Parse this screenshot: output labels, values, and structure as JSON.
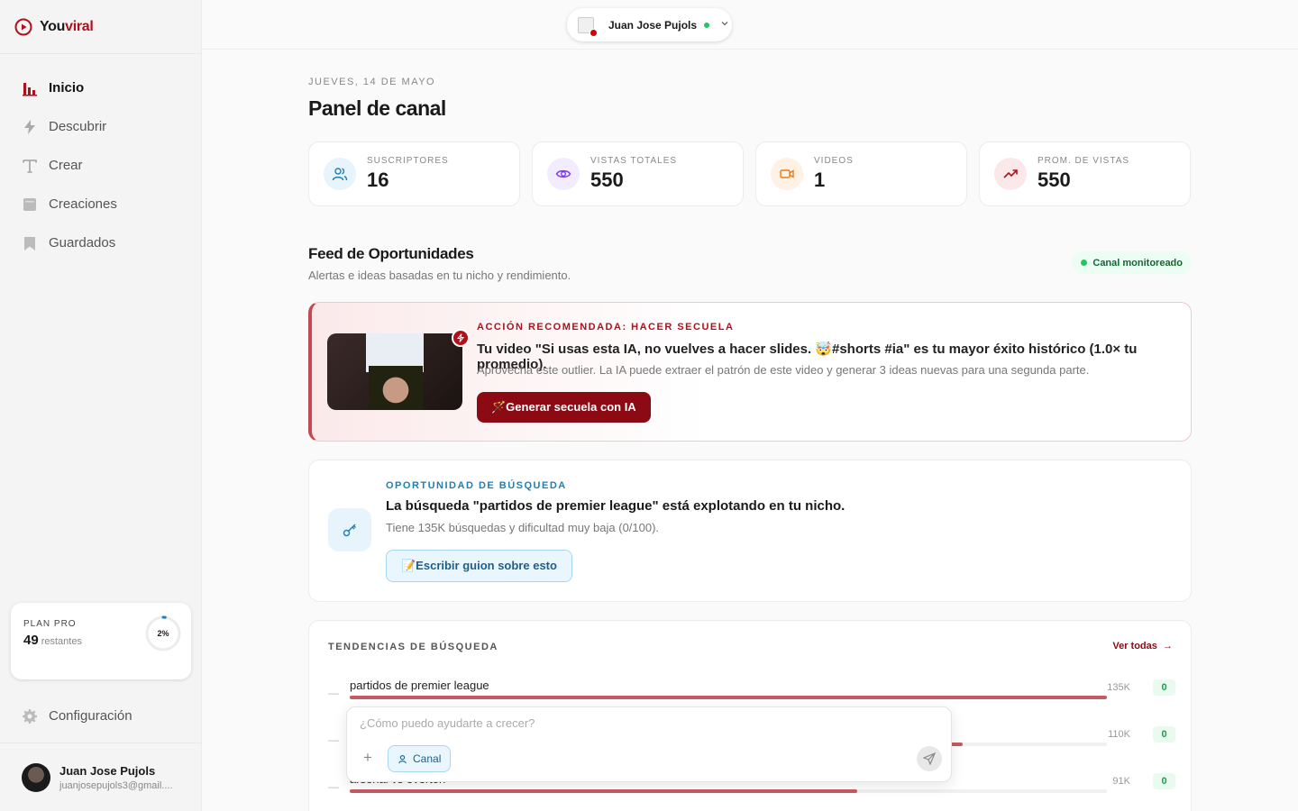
{
  "brand": {
    "name_part1": "You",
    "name_part2": "viral",
    "accent_color": "#b0101c"
  },
  "sidebar": {
    "items": [
      {
        "label": "Inicio",
        "icon": "bar-chart-icon",
        "active": true
      },
      {
        "label": "Descubrir",
        "icon": "lightning-icon"
      },
      {
        "label": "Crear",
        "icon": "text-icon"
      },
      {
        "label": "Creaciones",
        "icon": "folder-icon"
      },
      {
        "label": "Guardados",
        "icon": "bookmark-icon"
      }
    ],
    "plan": {
      "label": "PLAN PRO",
      "count": "49",
      "count_sub": "restantes",
      "percent_text": "2%",
      "percent": 2
    },
    "settings_label": "Configuración",
    "user": {
      "name": "Juan Jose Pujols",
      "email": "juanjosepujols3@gmail...."
    }
  },
  "topbar": {
    "channel_name": "Juan Jose Pujols"
  },
  "main": {
    "date": "JUEVES, 14 DE MAYO",
    "title": "Panel de canal",
    "stats": [
      {
        "label": "SUSCRIPTORES",
        "value": "16",
        "icon": "users-icon",
        "color": "#1d7fb5",
        "bg": "#e8f4fb"
      },
      {
        "label": "VISTAS TOTALES",
        "value": "550",
        "icon": "eye-icon",
        "color": "#7c3aed",
        "bg": "#f3ecff"
      },
      {
        "label": "VIDEOS",
        "value": "1",
        "icon": "video-icon",
        "color": "#ea7a1a",
        "bg": "#fff1e4"
      },
      {
        "label": "PROM. DE VISTAS",
        "value": "550",
        "icon": "trending-up-icon",
        "color": "#b0101c",
        "bg": "#fbe9ea"
      }
    ],
    "feed": {
      "title": "Feed de Oportunidades",
      "subtitle": "Alertas e ideas basadas en tu nicho y rendimiento.",
      "status": "Canal monitoreado"
    },
    "recommendation": {
      "kicker": "ACCIÓN RECOMENDADA: HACER SECUELA",
      "title": "Tu video \"Si usas esta IA, no vuelves a hacer slides. 🤯#shorts #ia\" es tu mayor éxito histórico (1.0× tu promedio).",
      "description": "Aprovecha este outlier. La IA puede extraer el patrón de este video y generar 3 ideas nuevas para una segunda parte.",
      "button": "🪄Generar secuela con IA"
    },
    "search_opportunity": {
      "kicker": "OPORTUNIDAD DE BÚSQUEDA",
      "title": "La búsqueda \"partidos de premier league\" está explotando en tu nicho.",
      "description": "Tiene 135K búsquedas y dificultad muy baja (0/100).",
      "button": "📝Escribir guion sobre esto"
    },
    "trends": {
      "title": "TENDENCIAS DE BÚSQUEDA",
      "link": "Ver todas",
      "rows": [
        {
          "name": "partidos de premier league",
          "volume": "135K",
          "score": "0",
          "fill": 1.0
        },
        {
          "name": "",
          "volume": "110K",
          "score": "0",
          "fill": 0.81
        },
        {
          "name": "arsenal vs everton",
          "volume": "91K",
          "score": "0",
          "fill": 0.67
        }
      ]
    }
  },
  "chat": {
    "placeholder": "¿Cómo puedo ayudarte a crecer?",
    "chip": "Canal"
  }
}
